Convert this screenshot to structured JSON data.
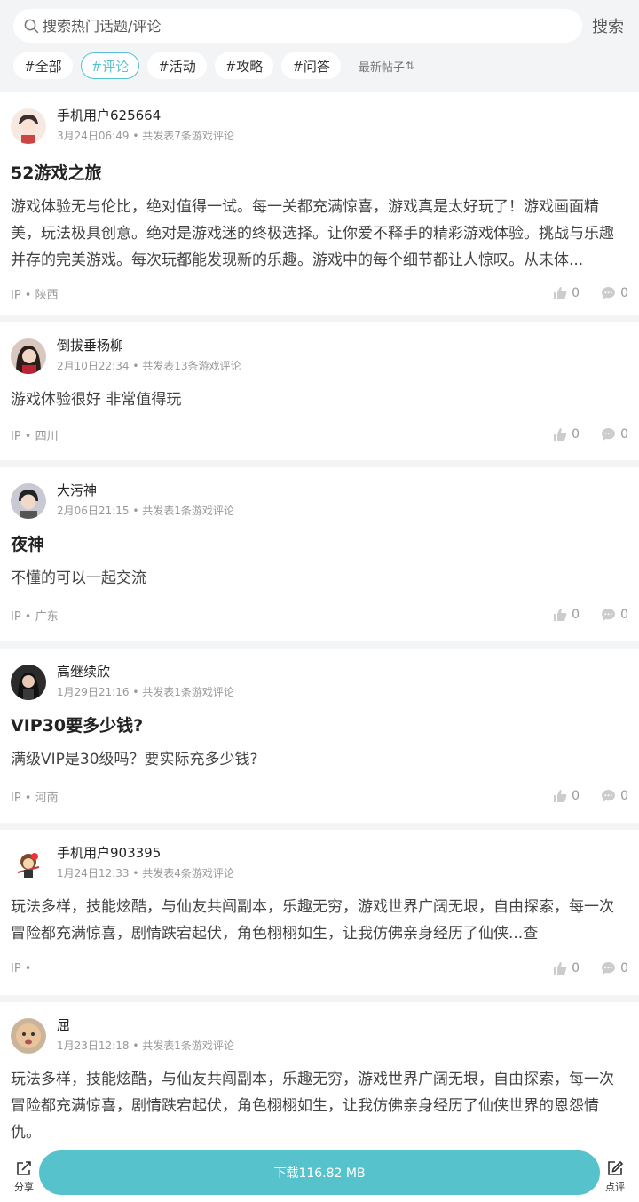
{
  "search": {
    "placeholder": "搜索热门话题/评论",
    "button": "搜索"
  },
  "tags": [
    "#全部",
    "#评论",
    "#活动",
    "#攻略",
    "#问答"
  ],
  "active_tag_index": 1,
  "sort_label": "最新帖子",
  "posts": [
    {
      "author": "手机用户625664",
      "time": "3月24日06:49",
      "count": "共发表7条游戏评论",
      "title": "52游戏之旅",
      "body": "游戏体验无与伦比，绝对值得一试。每一关都充满惊喜，游戏真是太好玩了！游戏画面精美，玩法极具创意。绝对是游戏迷的终极选择。让你爱不释手的精彩游戏体验。挑战与乐趣并存的完美游戏。每次玩都能发现新的乐趣。游戏中的每个细节都让人惊叹。从未体...",
      "ip": "IP • 陕西",
      "likes": "0",
      "comments": "0"
    },
    {
      "author": "倒拔垂杨柳",
      "time": "2月10日22:34",
      "count": "共发表13条游戏评论",
      "title": "",
      "body": "游戏体验很好 非常值得玩",
      "ip": "IP • 四川",
      "likes": "0",
      "comments": "0"
    },
    {
      "author": "大污神",
      "time": "2月06日21:15",
      "count": "共发表1条游戏评论",
      "title": "夜神",
      "body": "不懂的可以一起交流",
      "ip": "IP • 广东",
      "likes": "0",
      "comments": "0"
    },
    {
      "author": "高继续欣",
      "time": "1月29日21:16",
      "count": "共发表1条游戏评论",
      "title": "VIP30要多少钱?",
      "body": "满级VIP是30级吗？要实际充多少钱?",
      "ip": "IP • 河南",
      "likes": "0",
      "comments": "0"
    },
    {
      "author": "手机用户903395",
      "time": "1月24日12:33",
      "count": "共发表4条游戏评论",
      "title": "",
      "body": "玩法多样，技能炫酷，与仙友共闯副本，乐趣无穷，游戏世界广阔无垠，自由探索，每一次冒险都充满惊喜，剧情跌宕起伏，角色栩栩如生，让我仿佛亲身经历了仙侠...查",
      "ip": "IP •",
      "likes": "0",
      "comments": "0"
    },
    {
      "author": "屈",
      "time": "1月23日12:18",
      "count": "共发表1条游戏评论",
      "title": "",
      "body": "玩法多样，技能炫酷，与仙友共闯副本，乐趣无穷，游戏世界广阔无垠，自由探索，每一次冒险都充满惊喜，剧情跌宕起伏，角色栩栩如生，让我仿佛亲身经历了仙侠世界的恩怨情仇。",
      "ip": "",
      "likes": "",
      "comments": ""
    }
  ],
  "bottom": {
    "share": "分享",
    "download": "下载116.82 MB",
    "comment": "点评"
  },
  "colors": {
    "accent": "#56c2cc",
    "background": "#f3f4f6"
  }
}
